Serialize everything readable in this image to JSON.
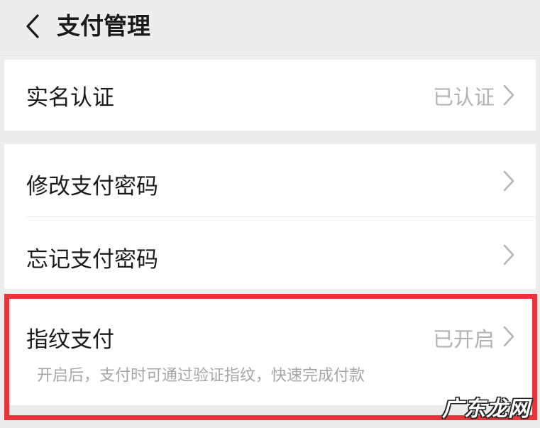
{
  "header": {
    "title": "支付管理",
    "back_icon": "chevron-left-icon"
  },
  "items": {
    "real_name": {
      "label": "实名认证",
      "value": "已认证"
    },
    "change_password": {
      "label": "修改支付密码"
    },
    "forgot_password": {
      "label": "忘记支付密码"
    },
    "fingerprint": {
      "label": "指纹支付",
      "value": "已开启",
      "description": "开启后，支付时可通过验证指纹，快速完成付款"
    }
  },
  "highlight_color": "#e8353a",
  "watermark": "广东龙网"
}
